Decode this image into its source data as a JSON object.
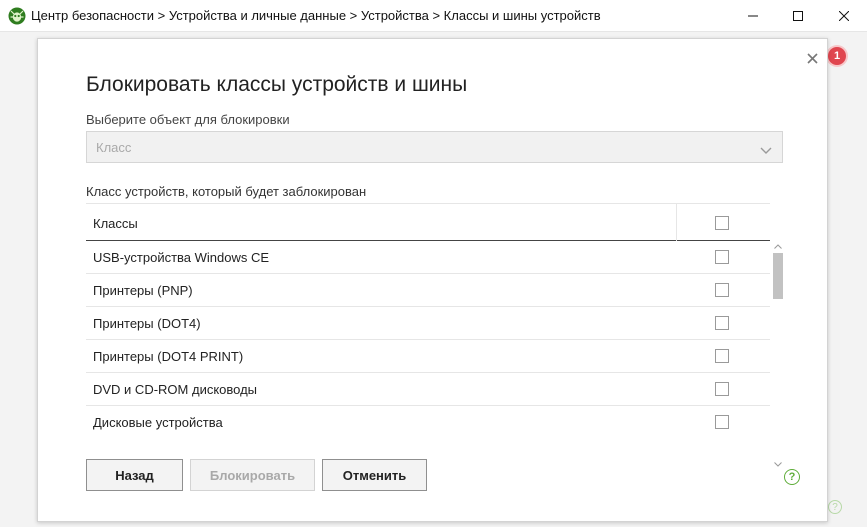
{
  "window": {
    "title": "Центр безопасности > Устройства и личные данные > Устройства > Классы и шины устройств",
    "logo_icon": "dr-web-spider-icon",
    "accent": "#5fad3a"
  },
  "background": {
    "notification_count": "1",
    "notification_color": "#e0464f",
    "help_glyph": "?"
  },
  "dialog": {
    "title": "Блокировать классы устройств и шины",
    "select_label": "Выберите объект для блокировки",
    "select_value": "Класс",
    "list_label": "Класс устройств, который будет заблокирован",
    "table": {
      "header": "Классы",
      "header_checked": false,
      "rows": [
        {
          "label": "USB-устройства Windows CE",
          "checked": false
        },
        {
          "label": "Принтеры (PNP)",
          "checked": false
        },
        {
          "label": "Принтеры (DOT4)",
          "checked": false
        },
        {
          "label": "Принтеры (DOT4 PRINT)",
          "checked": false
        },
        {
          "label": "DVD и CD-ROM дисководы",
          "checked": false
        },
        {
          "label": "Дисковые устройства",
          "checked": false
        }
      ]
    },
    "buttons": {
      "back": "Назад",
      "block": "Блокировать",
      "cancel": "Отменить"
    },
    "help_glyph": "?"
  }
}
